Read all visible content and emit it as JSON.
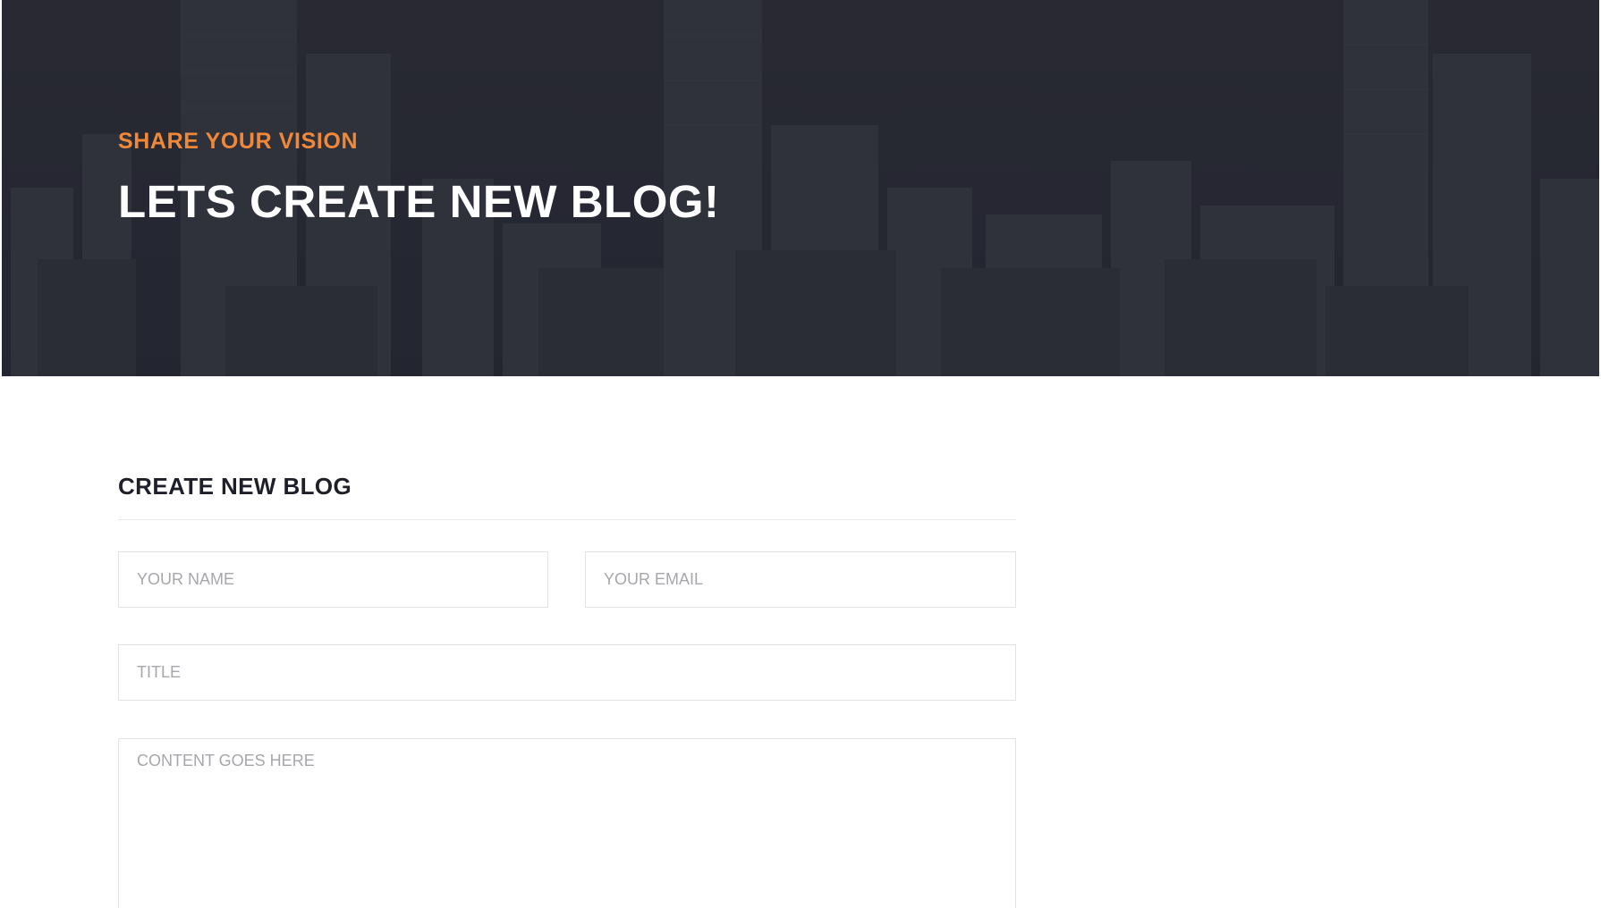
{
  "hero": {
    "eyebrow": "SHARE YOUR VISION",
    "title": "LETS CREATE NEW BLOG!"
  },
  "form": {
    "heading": "CREATE NEW BLOG",
    "name_placeholder": "YOUR NAME",
    "email_placeholder": "YOUR EMAIL",
    "title_placeholder": "TITLE",
    "content_placeholder": "CONTENT GOES HERE"
  },
  "colors": {
    "accent": "#f0883a",
    "heading": "#1f1f2a",
    "hero_overlay": "#2b2c36",
    "placeholder": "#a7a7ab",
    "border": "#e3e3e6"
  }
}
